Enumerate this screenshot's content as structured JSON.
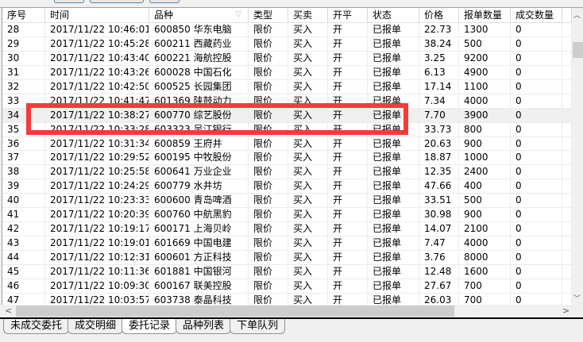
{
  "columns": [
    "序号",
    "时间",
    "品种",
    "类型",
    "买卖",
    "开平",
    "状态",
    "价格",
    "报单数量",
    "成交数量"
  ],
  "rows": [
    [
      "28",
      "2017/11/22 10:46:01",
      "600850 华东电脑",
      "限价",
      "买入",
      "开",
      "已报单",
      "22.73",
      "1300",
      "0"
    ],
    [
      "29",
      "2017/11/22 10:45:28",
      "600211 西藏药业",
      "限价",
      "买入",
      "开",
      "已报单",
      "38.24",
      "500",
      "0"
    ],
    [
      "30",
      "2017/11/22 10:43:40",
      "600221 海航控股",
      "限价",
      "买入",
      "开",
      "已报单",
      "3.25",
      "9200",
      "0"
    ],
    [
      "31",
      "2017/11/22 10:43:26",
      "600028 中国石化",
      "限价",
      "买入",
      "开",
      "已报单",
      "6.13",
      "4900",
      "0"
    ],
    [
      "32",
      "2017/11/22 10:42:50",
      "600525 长园集团",
      "限价",
      "买入",
      "开",
      "已报单",
      "17.14",
      "1100",
      "0"
    ],
    [
      "33",
      "2017/11/22 10:41:47",
      "601369 陕鼓动力",
      "限价",
      "买入",
      "开",
      "已报单",
      "7.34",
      "4000",
      "0"
    ],
    [
      "34",
      "2017/11/22 10:38:27",
      "600770 综艺股份",
      "限价",
      "买入",
      "开",
      "已报单",
      "7.70",
      "3900",
      "0"
    ],
    [
      "35",
      "2017/11/22 10:33:28",
      "603323 吴江银行",
      "限价",
      "买入",
      "开",
      "已报单",
      "33.73",
      "800",
      "0"
    ],
    [
      "36",
      "2017/11/22 10:31:34",
      "600859 王府井",
      "限价",
      "买入",
      "开",
      "已报单",
      "20.63",
      "900",
      "0"
    ],
    [
      "37",
      "2017/11/22 10:29:52",
      "600195 中牧股份",
      "限价",
      "买入",
      "开",
      "已报单",
      "18.87",
      "1000",
      "0"
    ],
    [
      "38",
      "2017/11/22 10:25:58",
      "600641 万业企业",
      "限价",
      "买入",
      "开",
      "已报单",
      "12.35",
      "2400",
      "0"
    ],
    [
      "39",
      "2017/11/22 10:24:29",
      "600779 水井坊",
      "限价",
      "买入",
      "开",
      "已报单",
      "47.66",
      "400",
      "0"
    ],
    [
      "40",
      "2017/11/22 10:23:33",
      "600600 青岛啤酒",
      "限价",
      "买入",
      "开",
      "已报单",
      "33.51",
      "500",
      "0"
    ],
    [
      "41",
      "2017/11/22 10:20:39",
      "600760 中航黑豹",
      "限价",
      "买入",
      "开",
      "已报单",
      "30.98",
      "900",
      "0"
    ],
    [
      "42",
      "2017/11/22 10:19:17",
      "600171 上海贝岭",
      "限价",
      "买入",
      "开",
      "已报单",
      "14.07",
      "2100",
      "0"
    ],
    [
      "43",
      "2017/11/22 10:19:01",
      "601669 中国电建",
      "限价",
      "买入",
      "开",
      "已报单",
      "7.47",
      "4000",
      "0"
    ],
    [
      "44",
      "2017/11/22 10:12:31",
      "600601 方正科技",
      "限价",
      "买入",
      "开",
      "已报单",
      "3.76",
      "8000",
      "0"
    ],
    [
      "45",
      "2017/11/22 10:11:36",
      "601881 中国银河",
      "限价",
      "买入",
      "开",
      "已报单",
      "12.48",
      "1600",
      "0"
    ],
    [
      "46",
      "2017/11/22 10:09:30",
      "600167 联美控股",
      "限价",
      "买入",
      "开",
      "已报单",
      "27.67",
      "700",
      "0"
    ],
    [
      "47",
      "2017/11/22 10:03:57",
      "603738 泰晶科技",
      "限价",
      "买入",
      "开",
      "已报单",
      "26.03",
      "700",
      "0"
    ]
  ],
  "selected_row": "34",
  "tabs": [
    "未成交委托",
    "成交明细",
    "委托记录",
    "品种列表",
    "下单队列"
  ],
  "active_tab": "委托记录",
  "highlight_color": "#f43b3b"
}
